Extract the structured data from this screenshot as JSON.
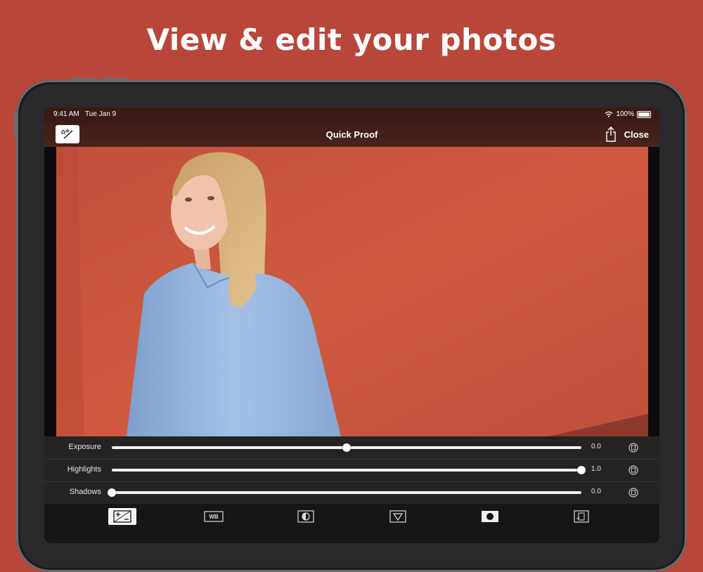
{
  "headline": "View & edit your photos",
  "status": {
    "time": "9:41 AM",
    "date": "Tue Jan 9",
    "battery": "100%"
  },
  "nav": {
    "title": "Quick Proof",
    "close_label": "Close"
  },
  "sliders": [
    {
      "label": "Exposure",
      "value": "0.0",
      "level": 0.5
    },
    {
      "label": "Highlights",
      "value": "1.0",
      "level": 1.0
    },
    {
      "label": "Shadows",
      "value": "0.0",
      "level": 0.0
    }
  ],
  "toolbar": {
    "items": [
      {
        "icon": "exposure-icon",
        "active": true
      },
      {
        "icon": "wb-icon",
        "text": "WB",
        "active": false
      },
      {
        "icon": "contrast-icon",
        "active": false
      },
      {
        "icon": "tone-curve-icon",
        "active": false
      },
      {
        "icon": "vignette-icon",
        "active": false
      },
      {
        "icon": "transform-icon",
        "active": false
      }
    ]
  },
  "colors": {
    "background": "#b8473a",
    "wall": "#c9543c",
    "shirt": "#8fb0d8",
    "hair": "#d7b378"
  }
}
